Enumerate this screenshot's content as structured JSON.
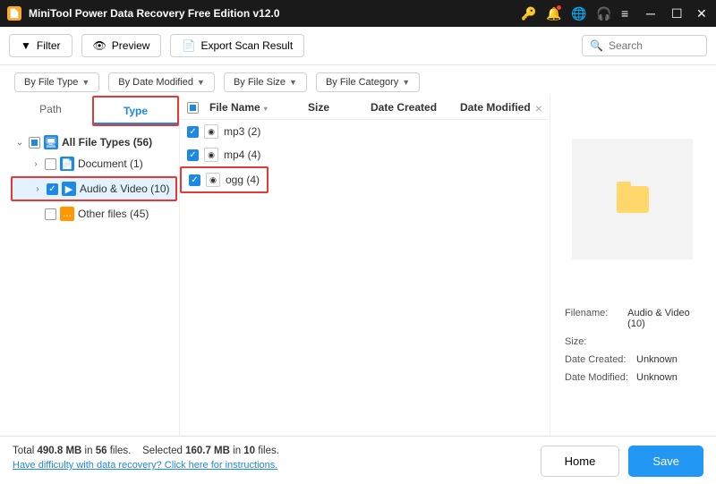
{
  "window": {
    "title": "MiniTool Power Data Recovery Free Edition v12.0"
  },
  "toolbar": {
    "filter": "Filter",
    "preview": "Preview",
    "export": "Export Scan Result",
    "search_placeholder": "Search"
  },
  "filters": {
    "type": "By File Type",
    "date": "By Date Modified",
    "size": "By File Size",
    "category": "By File Category"
  },
  "tabs": {
    "path": "Path",
    "type": "Type"
  },
  "tree": {
    "all": "All File Types (56)",
    "document": "Document (1)",
    "av": "Audio & Video (10)",
    "other": "Other files (45)"
  },
  "columns": {
    "name": "File Name",
    "size": "Size",
    "created": "Date Created",
    "modified": "Date Modified"
  },
  "files": {
    "mp3": "mp3 (2)",
    "mp4": "mp4 (4)",
    "ogg": "ogg (4)"
  },
  "details": {
    "filename_label": "Filename:",
    "filename_value": "Audio & Video (10)",
    "size_label": "Size:",
    "size_value": "",
    "created_label": "Date Created:",
    "created_value": "Unknown",
    "modified_label": "Date Modified:",
    "modified_value": "Unknown"
  },
  "footer": {
    "total_prefix": "Total ",
    "total_size": "490.8 MB",
    "total_mid": " in ",
    "total_files": "56",
    "total_suffix": " files.",
    "sel_prefix": "Selected ",
    "sel_size": "160.7 MB",
    "sel_mid": " in ",
    "sel_files": "10",
    "sel_suffix": " files.",
    "help": "Have difficulty with data recovery? Click here for instructions.",
    "home": "Home",
    "save": "Save"
  }
}
